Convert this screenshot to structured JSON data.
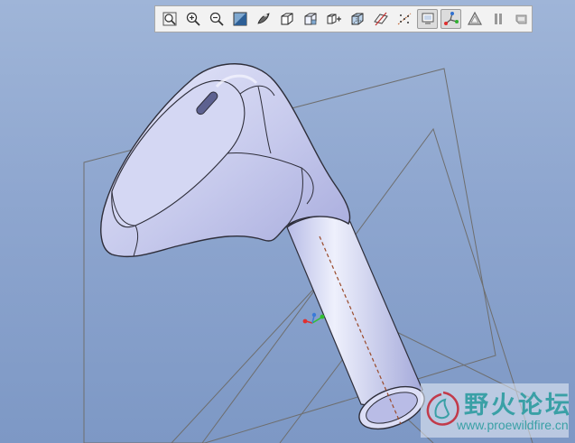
{
  "toolbar": {
    "buttons": [
      {
        "name": "refit",
        "icon": "zoom-fit-icon"
      },
      {
        "name": "zoom-in",
        "icon": "zoom-in-icon"
      },
      {
        "name": "zoom-out",
        "icon": "zoom-out-icon"
      },
      {
        "name": "repaint",
        "icon": "repaint-icon"
      },
      {
        "name": "shading",
        "icon": "shading-icon"
      },
      {
        "name": "shaded-edges",
        "icon": "shaded-edges-icon"
      },
      {
        "name": "hidden-line",
        "icon": "hidden-line-icon"
      },
      {
        "name": "no-hidden",
        "icon": "no-hidden-icon"
      },
      {
        "name": "wireframe",
        "icon": "wireframe-icon"
      },
      {
        "name": "datum-planes",
        "icon": "datum-planes-icon"
      },
      {
        "name": "datum-axes",
        "icon": "datum-axes-icon"
      },
      {
        "name": "datum-points",
        "icon": "datum-points-icon",
        "active": true
      },
      {
        "name": "coordinate-systems",
        "icon": "coordinate-system-icon",
        "active": true
      },
      {
        "name": "annotations",
        "icon": "annotation-icon"
      },
      {
        "name": "pause",
        "icon": "pause-icon"
      },
      {
        "name": "spin-center",
        "icon": "spin-center-icon"
      }
    ]
  },
  "watermark": {
    "title": "野火论坛",
    "url": "www.proewildfire.cn",
    "logo_icon": "wildfire-logo-icon"
  },
  "colors": {
    "background_top": "#9fb5d8",
    "background_bottom": "#7d98c5",
    "model_fill": "#c9cdee",
    "datum_line": "#6e6e6e",
    "axis_line": "#9a4a2a",
    "watermark_text": "#3aa0a6"
  }
}
